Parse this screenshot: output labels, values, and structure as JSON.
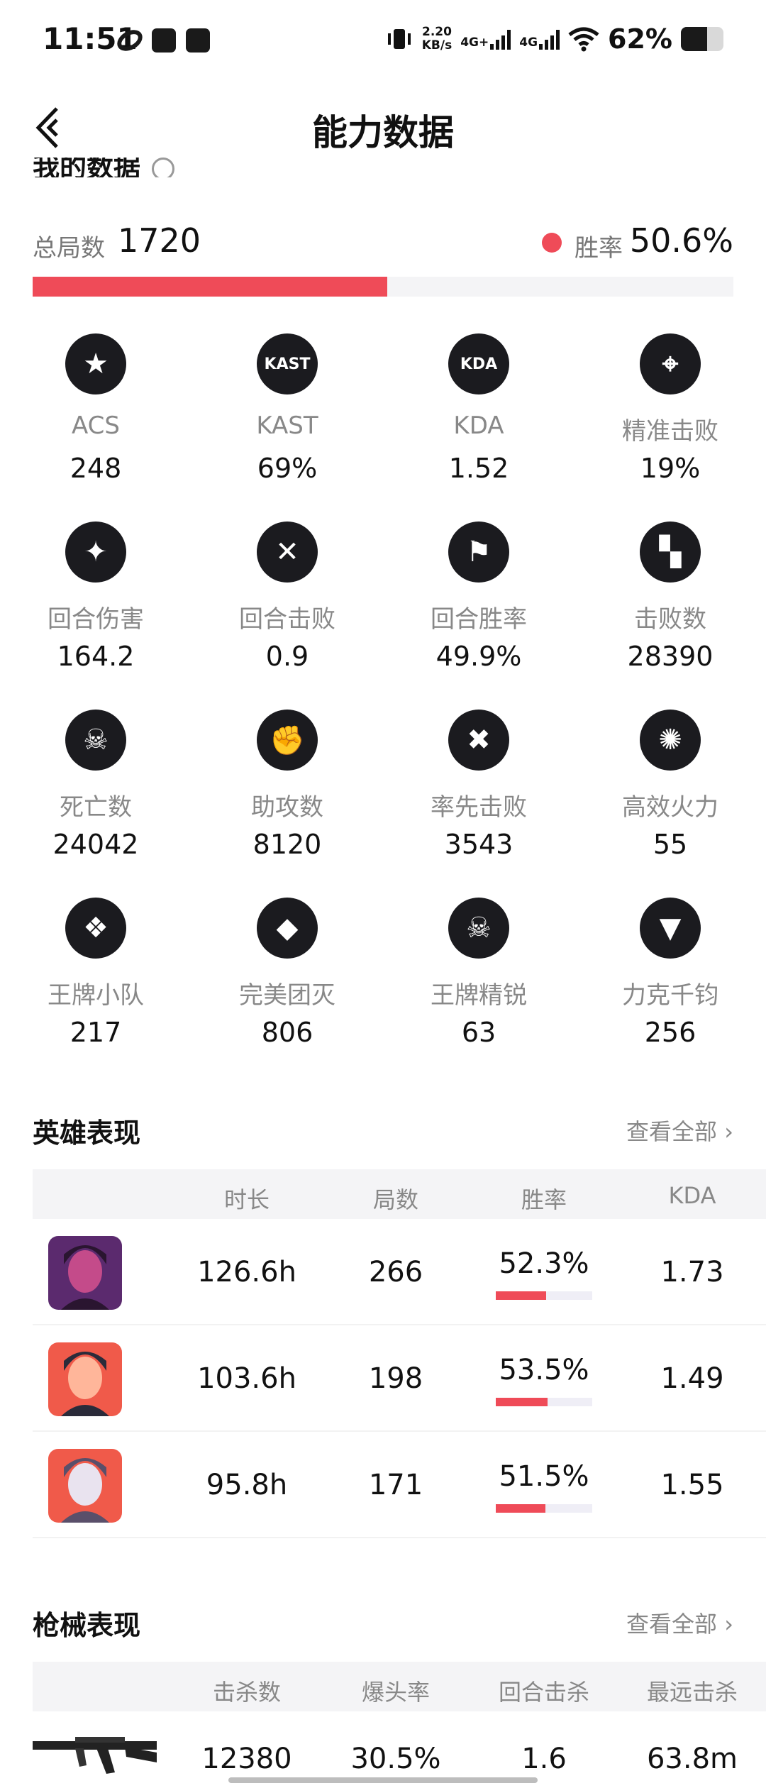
{
  "status_bar": {
    "time": "11:51",
    "speed_value": "2.20",
    "speed_unit": "KB/s",
    "network_1": "4G+",
    "network_2": "4G",
    "battery_percent": "62%",
    "battery_level": 0.62
  },
  "header": {
    "title": "能力数据"
  },
  "my_data": {
    "section_title": "我的数据",
    "total_games_label": "总局数",
    "total_games": "1720",
    "win_rate_label": "胜率",
    "win_rate": "50.6%",
    "win_rate_fraction": 0.506,
    "accent_color": "#ef4b58"
  },
  "stats": [
    {
      "icon": "star-badge-icon",
      "glyph": "★",
      "label": "ACS",
      "value": "248"
    },
    {
      "icon": "kast-icon",
      "glyph": "KAST",
      "label": "KAST",
      "value": "69%"
    },
    {
      "icon": "kda-icon",
      "glyph": "KDA",
      "label": "KDA",
      "value": "1.52"
    },
    {
      "icon": "crosshair-skull-icon",
      "glyph": "⌖",
      "label": "精准击败",
      "value": "19%"
    },
    {
      "icon": "damage-icon",
      "glyph": "✦",
      "label": "回合伤害",
      "value": "164.2"
    },
    {
      "icon": "blades-icon",
      "glyph": "✕",
      "label": "回合击败",
      "value": "0.9"
    },
    {
      "icon": "flag-icon",
      "glyph": "⚑",
      "label": "回合胜率",
      "value": "49.9%"
    },
    {
      "icon": "pistol-icon",
      "glyph": "▚",
      "label": "击败数",
      "value": "28390"
    },
    {
      "icon": "skull-icon",
      "glyph": "☠",
      "label": "死亡数",
      "value": "24042"
    },
    {
      "icon": "fist-icon",
      "glyph": "✊",
      "label": "助攻数",
      "value": "8120"
    },
    {
      "icon": "first-blood-icon",
      "glyph": "✖",
      "label": "率先击败",
      "value": "3543"
    },
    {
      "icon": "firepower-icon",
      "glyph": "✺",
      "label": "高效火力",
      "value": "55"
    },
    {
      "icon": "ace-squad-icon",
      "glyph": "❖",
      "label": "王牌小队",
      "value": "217"
    },
    {
      "icon": "diamond-icon",
      "glyph": "◆",
      "label": "完美团灭",
      "value": "806"
    },
    {
      "icon": "elite-skull-icon",
      "glyph": "☠",
      "label": "王牌精锐",
      "value": "63"
    },
    {
      "icon": "eagle-icon",
      "glyph": "▼",
      "label": "力克千钧",
      "value": "256"
    }
  ],
  "hero_section": {
    "title": "英雄表现",
    "more_label": "查看全部",
    "columns": [
      "时长",
      "局数",
      "胜率",
      "KDA"
    ],
    "rows": [
      {
        "agent": "agent-1",
        "duration": "126.6h",
        "games": "266",
        "win_rate": "52.3%",
        "win_fraction": 0.523,
        "kda": "1.73"
      },
      {
        "agent": "agent-2",
        "duration": "103.6h",
        "games": "198",
        "win_rate": "53.5%",
        "win_fraction": 0.535,
        "kda": "1.49"
      },
      {
        "agent": "agent-3",
        "duration": "95.8h",
        "games": "171",
        "win_rate": "51.5%",
        "win_fraction": 0.515,
        "kda": "1.55"
      }
    ]
  },
  "weapon_section": {
    "title": "枪械表现",
    "more_label": "查看全部",
    "columns": [
      "击杀数",
      "爆头率",
      "回合击杀",
      "最远击杀"
    ],
    "rows": [
      {
        "weapon": "rifle",
        "kills": "12380",
        "headshot_rate": "30.5%",
        "round_kills": "1.6",
        "longest_kill": "63.8m"
      }
    ]
  }
}
